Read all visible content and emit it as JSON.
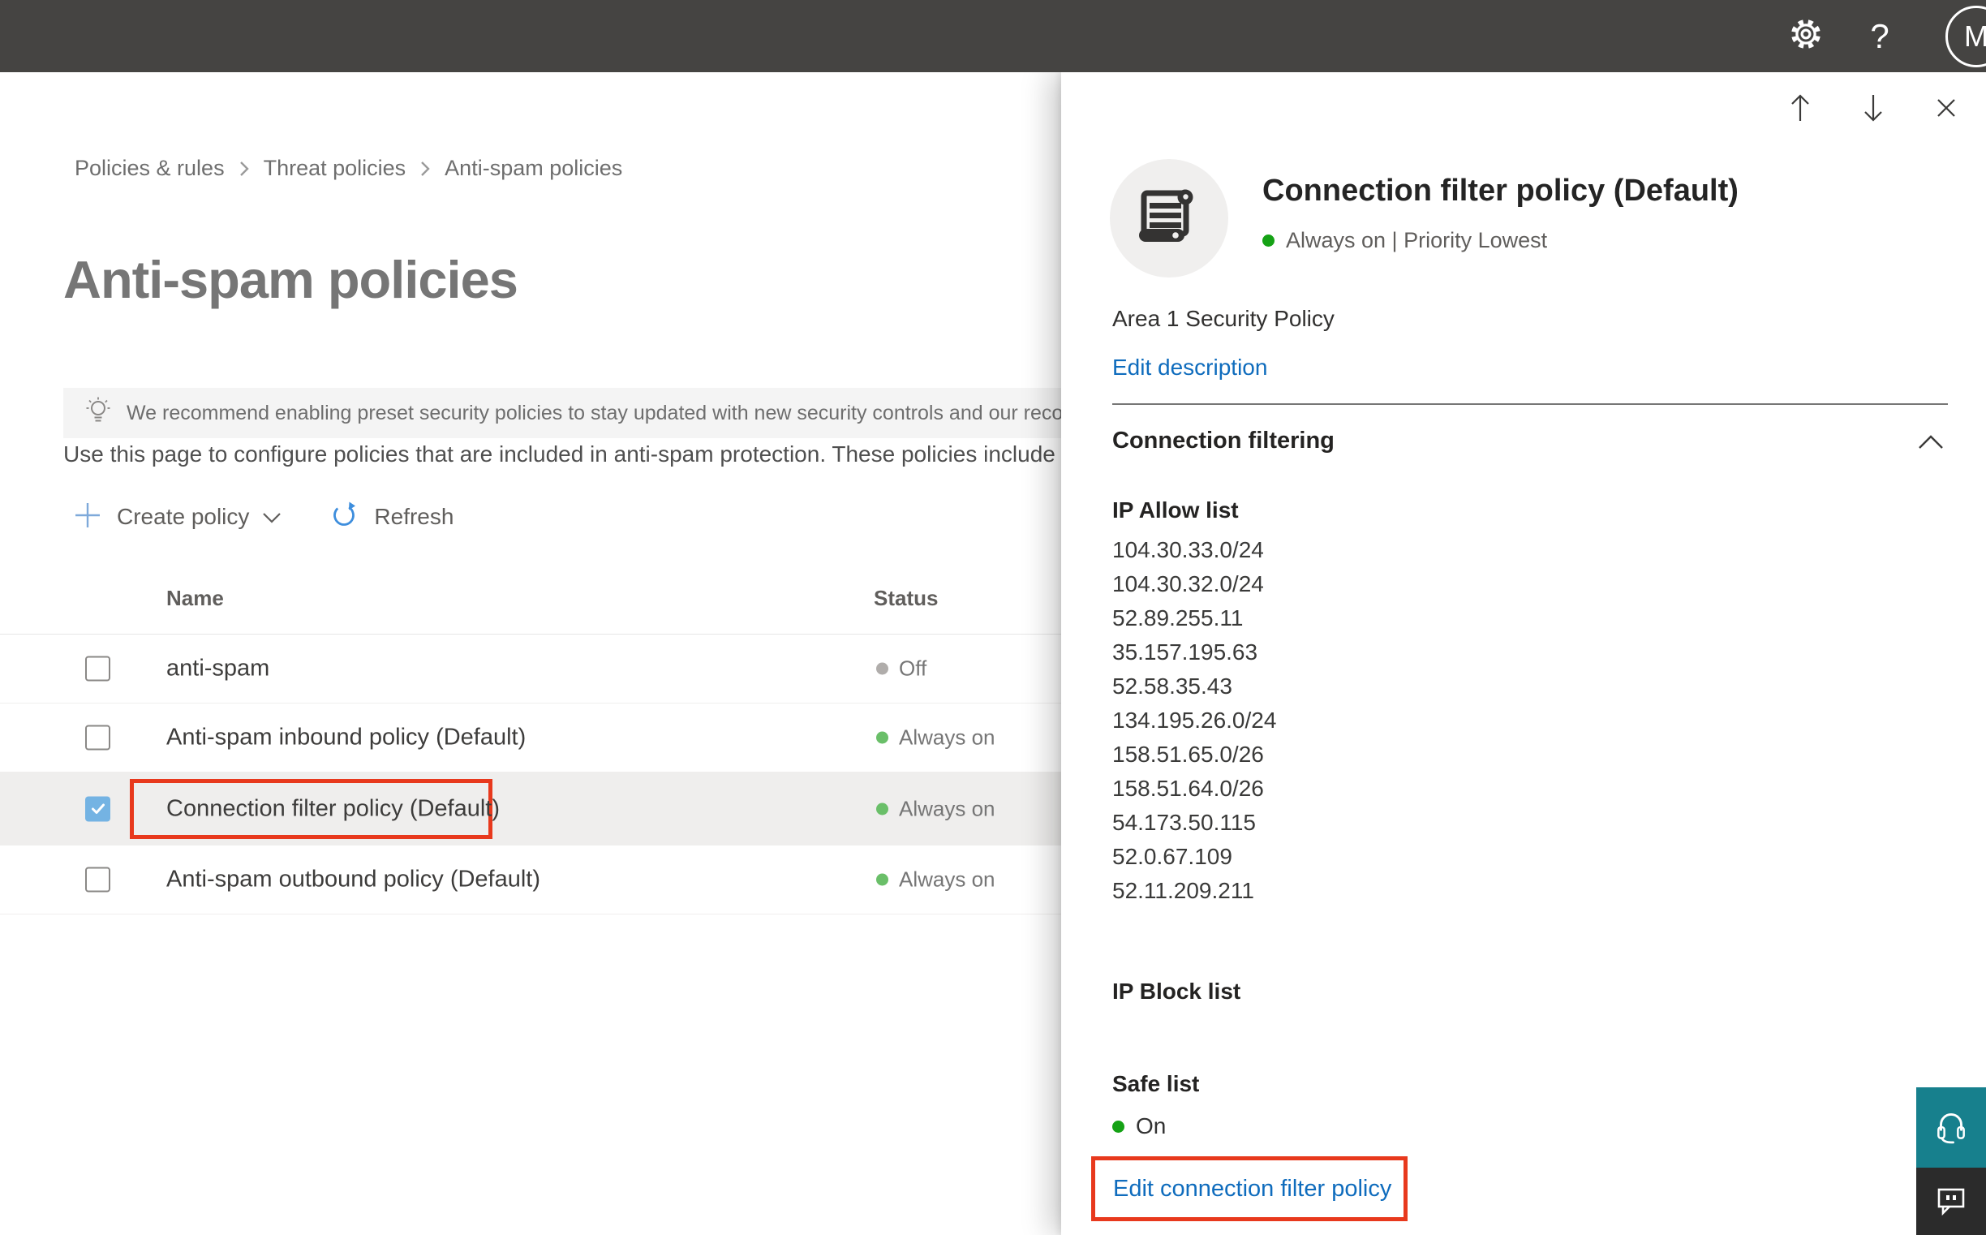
{
  "topbar": {
    "help_glyph": "?",
    "avatar_initial": "M"
  },
  "breadcrumb": {
    "items": [
      "Policies & rules",
      "Threat policies",
      "Anti-spam policies"
    ]
  },
  "page": {
    "title": "Anti-spam policies",
    "banner_text": "We recommend enabling preset security policies to stay updated with new security controls and our recomme",
    "description": "Use this page to configure policies that are included in anti-spam protection. These policies include",
    "toolbar": {
      "create": "Create policy",
      "refresh": "Refresh"
    }
  },
  "table": {
    "columns": {
      "name": "Name",
      "status": "Status"
    },
    "rows": [
      {
        "name": "anti-spam",
        "status": "Off"
      },
      {
        "name": "Anti-spam inbound policy (Default)",
        "status": "Always on"
      },
      {
        "name": "Connection filter policy (Default)",
        "status": "Always on"
      },
      {
        "name": "Anti-spam outbound policy (Default)",
        "status": "Always on"
      }
    ]
  },
  "flyout": {
    "title": "Connection filter policy (Default)",
    "status_line": "Always on | Priority Lowest",
    "description": "Area 1 Security Policy",
    "edit_description": "Edit description",
    "section_title": "Connection filtering",
    "ip_allow_label": "IP Allow list",
    "ip_allow": [
      "104.30.33.0/24",
      "104.30.32.0/24",
      "52.89.255.11",
      "35.157.195.63",
      "52.58.35.43",
      "134.195.26.0/24",
      "158.51.65.0/26",
      "158.51.64.0/26",
      "54.173.50.115",
      "52.0.67.109",
      "52.11.209.211"
    ],
    "ip_block_label": "IP Block list",
    "safe_list_label": "Safe list",
    "safe_list_status": "On",
    "edit_link": "Edit connection filter policy"
  },
  "colors": {
    "topbar": "#454442",
    "accent_blue": "#0f6cbd",
    "annotation_red": "#e8391d",
    "status_on_green": "#6abf69",
    "status_off_gray": "#b0adab",
    "flyout_green": "#15a215",
    "teal": "#17808d"
  }
}
